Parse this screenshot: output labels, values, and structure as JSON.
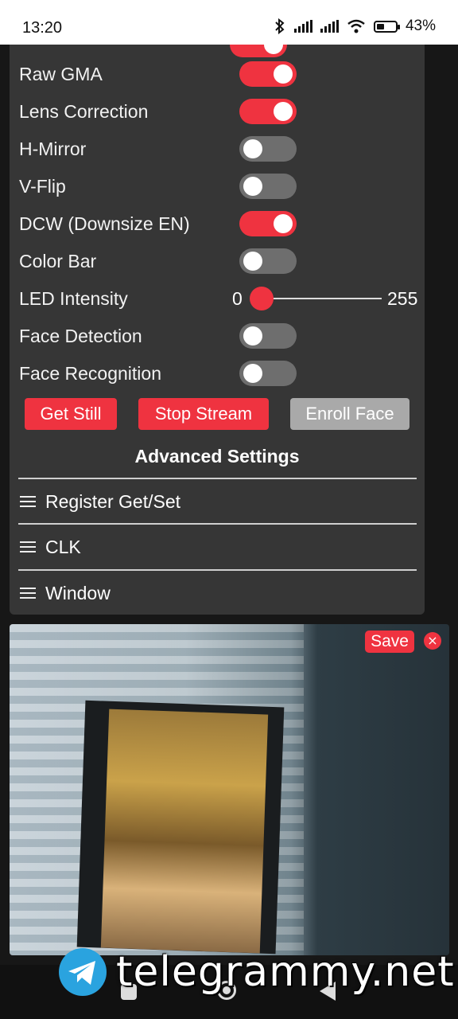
{
  "status_bar": {
    "time": "13:20",
    "battery_text": "43%",
    "battery_level": 0.43,
    "icons": [
      "bluetooth-icon",
      "signal-icon",
      "signal-icon",
      "wifi-icon",
      "battery-icon"
    ]
  },
  "settings": {
    "toggles": [
      {
        "label": "Raw GMA",
        "on": true
      },
      {
        "label": "Lens Correction",
        "on": true
      },
      {
        "label": "H-Mirror",
        "on": false
      },
      {
        "label": "V-Flip",
        "on": false
      },
      {
        "label": "DCW (Downsize EN)",
        "on": true
      },
      {
        "label": "Color Bar",
        "on": false
      }
    ],
    "led": {
      "label": "LED Intensity",
      "min": "0",
      "max": "255",
      "value": 0
    },
    "toggles2": [
      {
        "label": "Face Detection",
        "on": false
      },
      {
        "label": "Face Recognition",
        "on": false
      }
    ],
    "buttons": {
      "get_still": "Get Still",
      "stop_stream": "Stop Stream",
      "enroll_face": "Enroll Face"
    },
    "advanced_title": "Advanced Settings",
    "sections": [
      "Register Get/Set",
      "CLK",
      "Window"
    ]
  },
  "camera": {
    "save_label": "Save",
    "close_label": "×"
  },
  "watermark": {
    "text": "telegrammy.net"
  },
  "colors": {
    "accent": "#ef3340",
    "panel": "#363636",
    "toggle_off": "#6e6e6e",
    "button_disabled": "#a9a9a9"
  }
}
